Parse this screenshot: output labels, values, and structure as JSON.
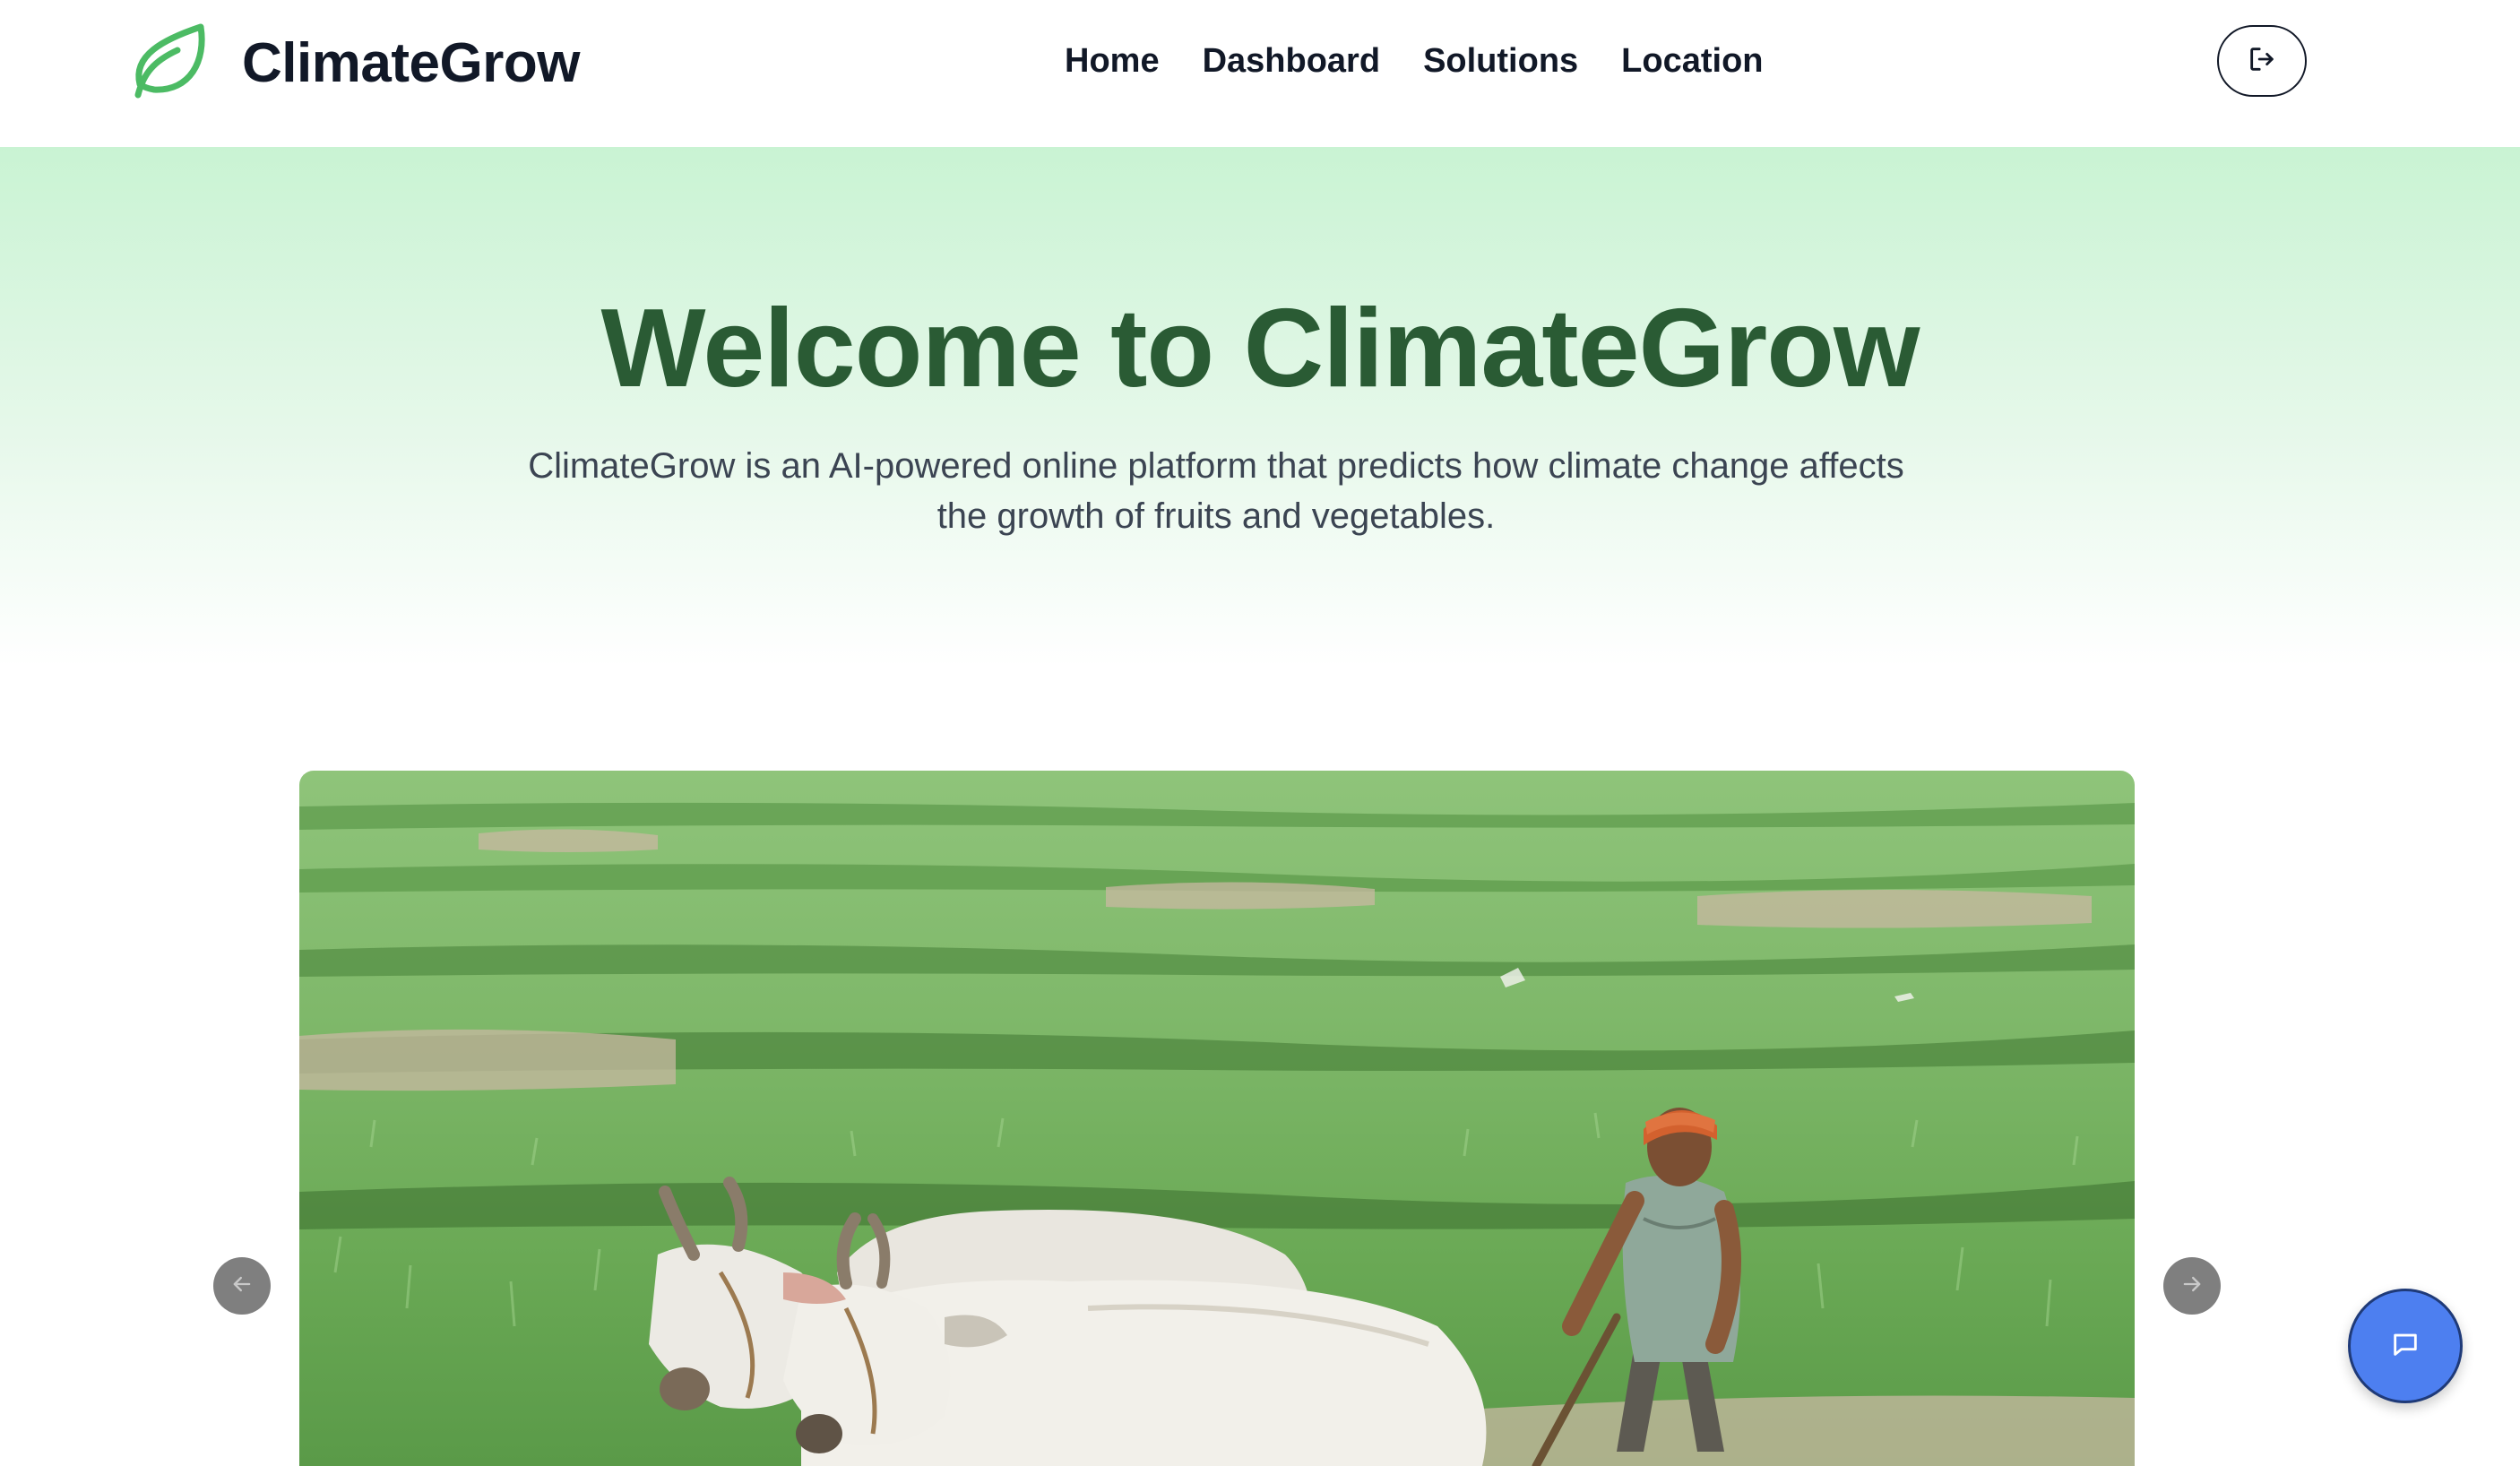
{
  "navbar": {
    "brand": "ClimateGrow",
    "links": [
      "Home",
      "Dashboard",
      "Solutions",
      "Location"
    ]
  },
  "hero": {
    "title": "Welcome to ClimateGrow",
    "description": "ClimateGrow is an AI-powered online platform that predicts how climate change affects the growth of fruits and vegetables."
  },
  "carousel": {
    "image": "farmer plowing rice paddy field with two white oxen"
  },
  "icons": {
    "logo": "leaf-icon",
    "logout": "logout-icon",
    "prev": "arrow-left-icon",
    "next": "arrow-right-icon",
    "chat": "chat-icon"
  },
  "colors": {
    "brand_green": "#2a5b34",
    "logo_green": "#4cbb64",
    "hero_bg_top": "#c9f3d3",
    "chat_blue": "#4d7ff0"
  }
}
